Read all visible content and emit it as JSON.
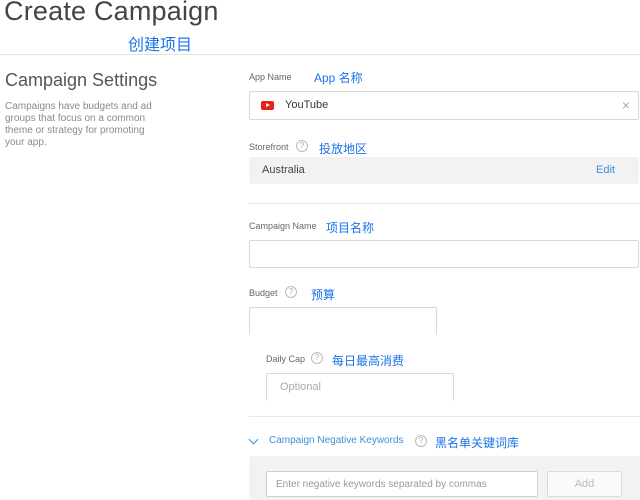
{
  "header": {
    "title": "Create Campaign",
    "title_note": "创建项目"
  },
  "settings": {
    "title": "Campaign Settings",
    "description": "Campaigns have budgets and ad groups that focus on a common theme or strategy for promoting your app."
  },
  "app_name": {
    "label": "App Name",
    "note": "App 名称",
    "value": "YouTube",
    "icon": "youtube-icon",
    "clear_icon": "close-icon",
    "clear_glyph": "×"
  },
  "storefront": {
    "label": "Storefront",
    "note": "投放地区",
    "value": "Australia",
    "edit_label": "Edit"
  },
  "campaign_name": {
    "label": "Campaign Name",
    "note": "项目名称",
    "value": ""
  },
  "budget": {
    "label": "Budget",
    "note": "预算",
    "value": ""
  },
  "daily_cap": {
    "label": "Daily Cap",
    "note": "每日最高消费",
    "placeholder": "Optional"
  },
  "negative_keywords": {
    "label": "Campaign Negative Keywords",
    "note": "黑名单关键词库",
    "placeholder": "Enter negative keywords separated by commas",
    "add_label": "Add",
    "expanded": true
  },
  "help_glyph": "?",
  "colors": {
    "accent": "#3d8fd6",
    "annotation": "#1a73e8",
    "youtube_red": "#e62117"
  }
}
